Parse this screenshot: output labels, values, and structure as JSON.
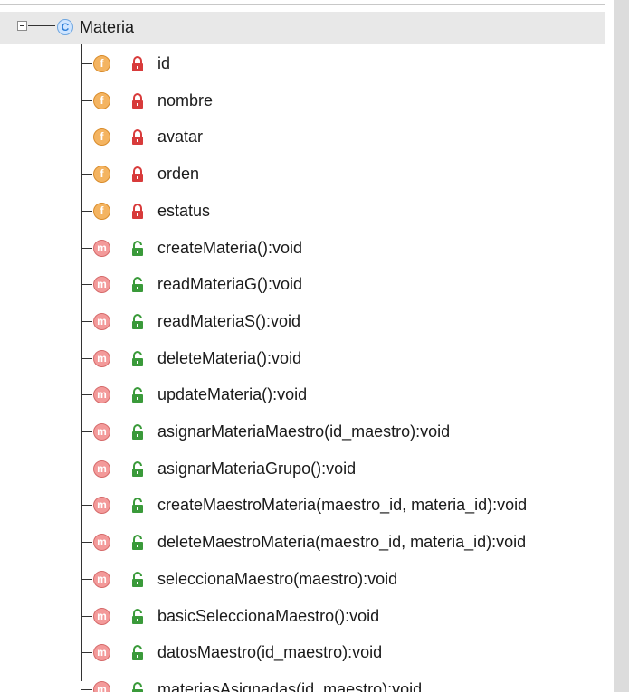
{
  "root": {
    "label": "Materia",
    "icon": "class-icon",
    "icon_letter": "C"
  },
  "members": [
    {
      "kind": "f",
      "visibility": "private",
      "label": "id"
    },
    {
      "kind": "f",
      "visibility": "private",
      "label": "nombre"
    },
    {
      "kind": "f",
      "visibility": "private",
      "label": "avatar"
    },
    {
      "kind": "f",
      "visibility": "private",
      "label": "orden"
    },
    {
      "kind": "f",
      "visibility": "private",
      "label": "estatus"
    },
    {
      "kind": "m",
      "visibility": "public",
      "label": "createMateria():void"
    },
    {
      "kind": "m",
      "visibility": "public",
      "label": "readMateriaG():void"
    },
    {
      "kind": "m",
      "visibility": "public",
      "label": "readMateriaS():void"
    },
    {
      "kind": "m",
      "visibility": "public",
      "label": "deleteMateria():void"
    },
    {
      "kind": "m",
      "visibility": "public",
      "label": "updateMateria():void"
    },
    {
      "kind": "m",
      "visibility": "public",
      "label": "asignarMateriaMaestro(id_maestro):void"
    },
    {
      "kind": "m",
      "visibility": "public",
      "label": "asignarMateriaGrupo():void"
    },
    {
      "kind": "m",
      "visibility": "public",
      "label": "createMaestroMateria(maestro_id, materia_id):void"
    },
    {
      "kind": "m",
      "visibility": "public",
      "label": "deleteMaestroMateria(maestro_id, materia_id):void"
    },
    {
      "kind": "m",
      "visibility": "public",
      "label": "seleccionaMaestro(maestro):void"
    },
    {
      "kind": "m",
      "visibility": "public",
      "label": "basicSeleccionaMaestro():void"
    },
    {
      "kind": "m",
      "visibility": "public",
      "label": "datosMaestro(id_maestro):void"
    },
    {
      "kind": "m",
      "visibility": "public",
      "label": "materiasAsignadas(id_maestro):void"
    }
  ],
  "colors": {
    "field_badge": "#f4b461",
    "method_badge": "#f39a9a",
    "private_lock": "#d83b3b",
    "public_lock": "#3a9a3a",
    "class_badge": "#cfe5ff"
  }
}
